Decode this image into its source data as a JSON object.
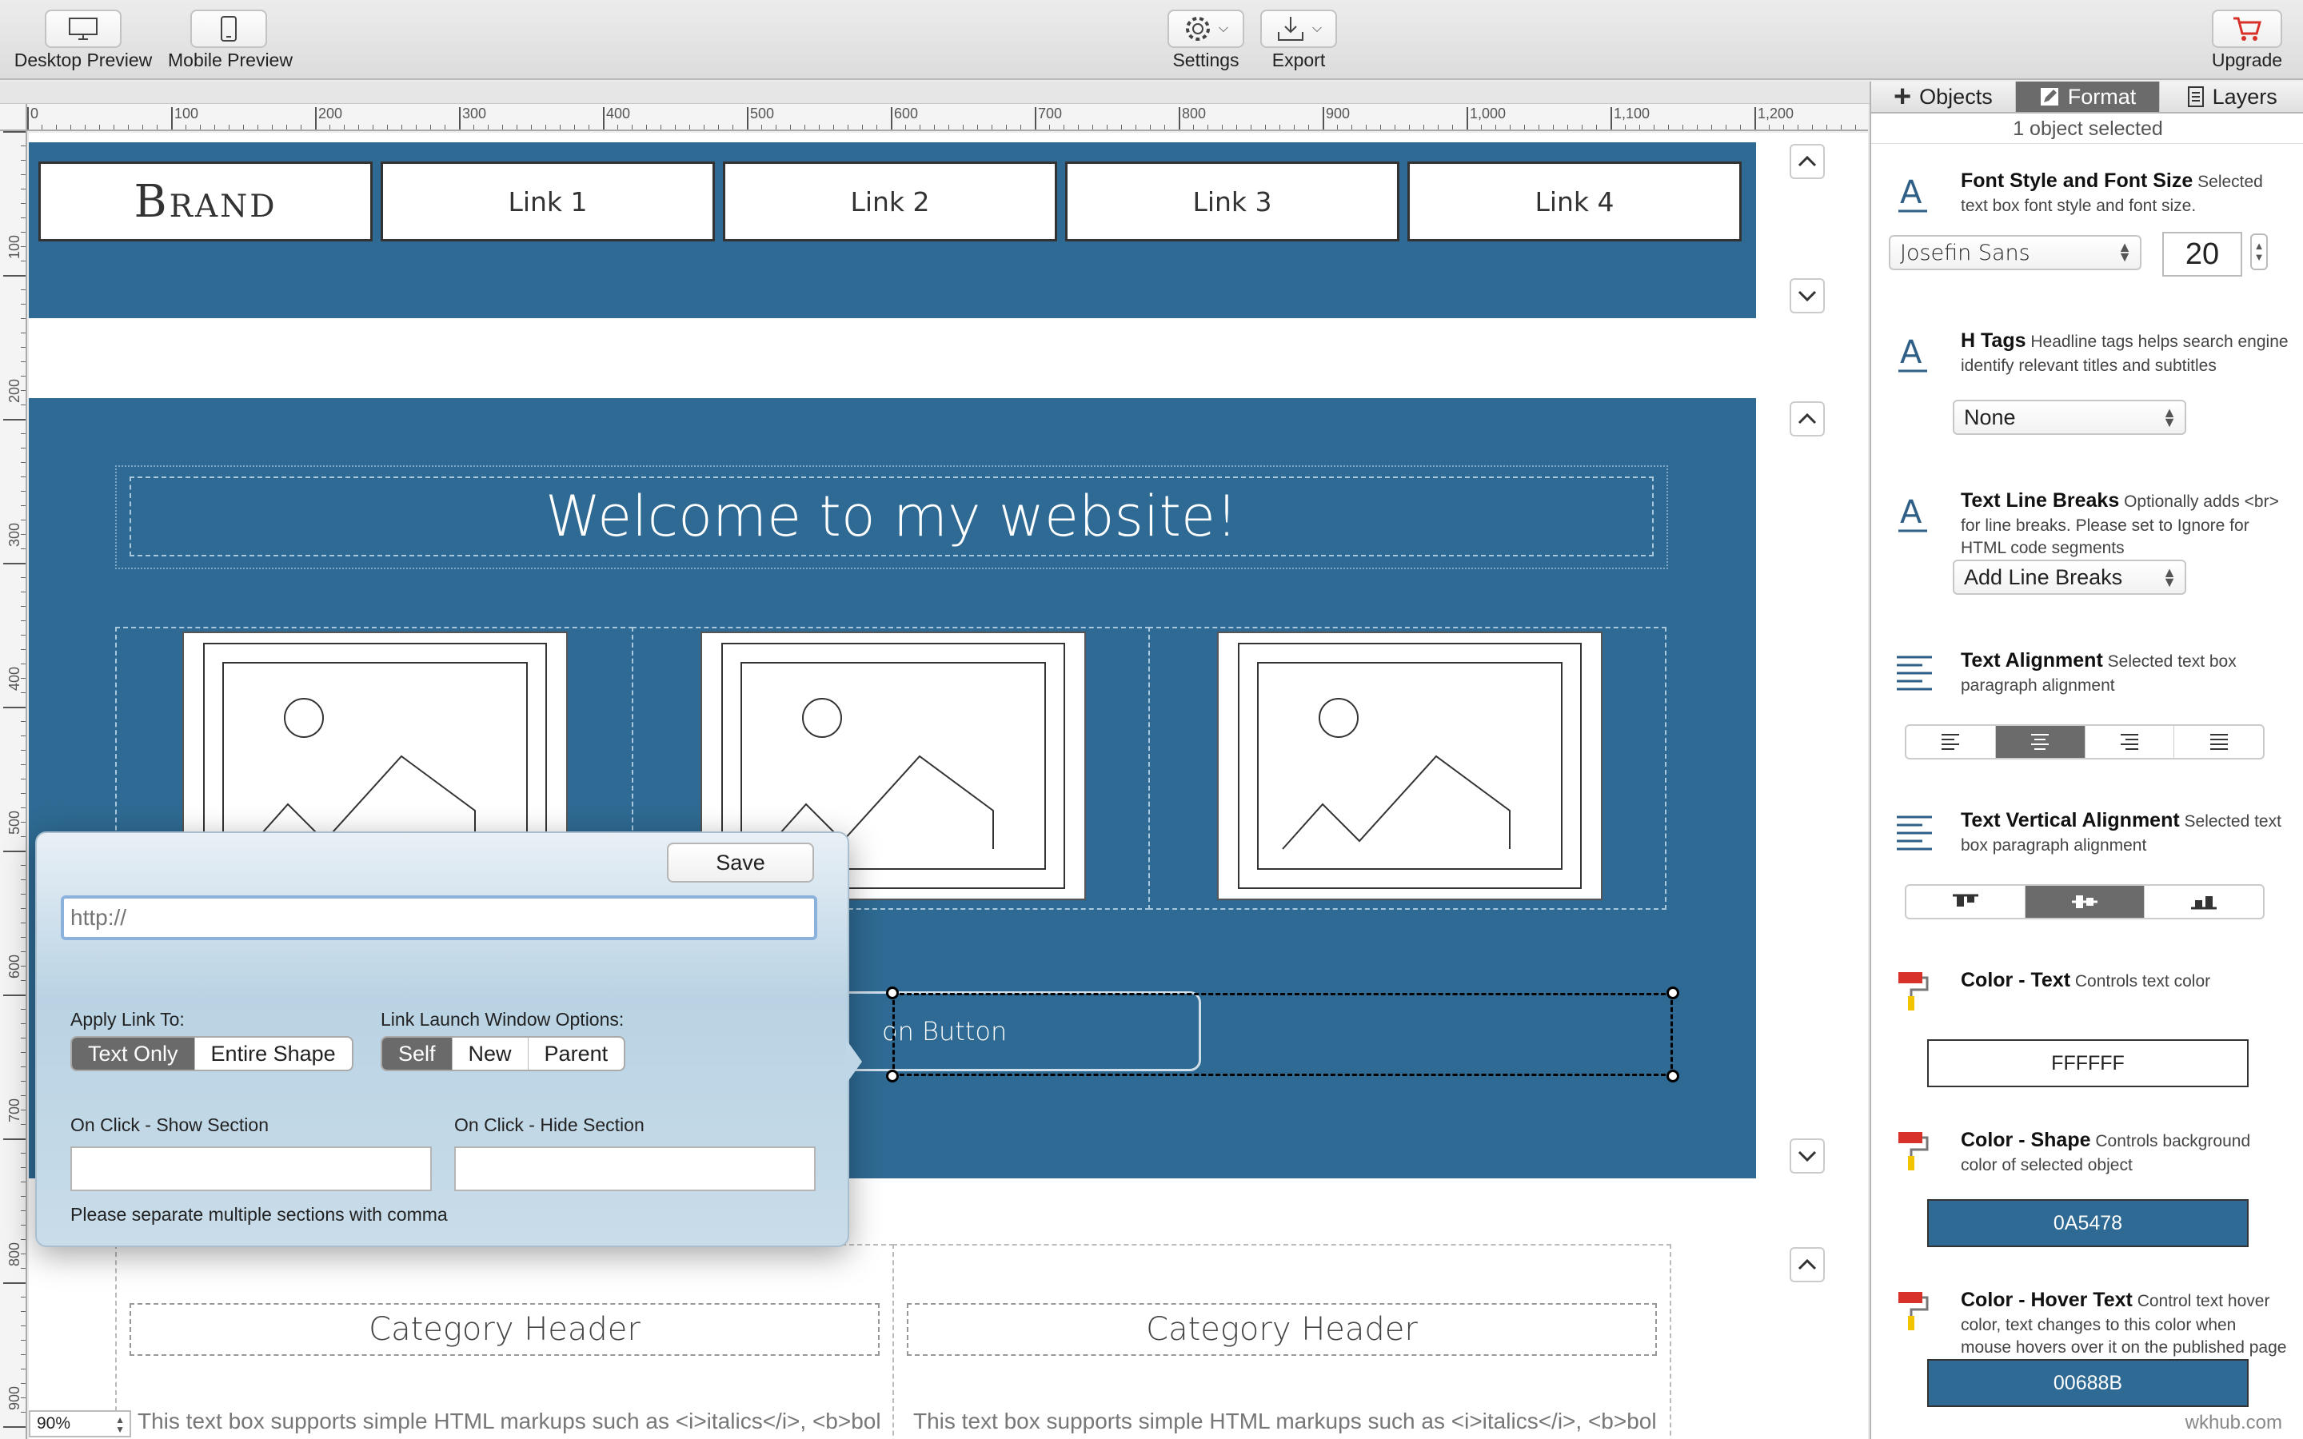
{
  "toolbar": {
    "desktop_preview": "Desktop Preview",
    "mobile_preview": "Mobile Preview",
    "settings": "Settings",
    "export": "Export",
    "upgrade": "Upgrade"
  },
  "ruler": {
    "top": [
      "0",
      "100",
      "200",
      "300",
      "400",
      "500",
      "600",
      "700",
      "800",
      "900",
      "1,000",
      "1,100",
      "1,200"
    ],
    "left": [
      "100",
      "200",
      "300",
      "400",
      "500",
      "600",
      "700",
      "800",
      "900"
    ]
  },
  "canvas": {
    "nav": {
      "brand": "Brand",
      "links": [
        "Link 1",
        "Link 2",
        "Link 3",
        "Link 4"
      ]
    },
    "welcome_title": "Welcome to my website!",
    "button_text": "on Button",
    "category_headers": [
      "Category Header",
      "Category Header"
    ],
    "body_text": [
      "This text box supports simple HTML markups such as <i>italics</i>, <b>bold</",
      "This text box supports simple HTML markups such as <i>italics</i>, <b>bold</"
    ],
    "band_color": "#2E6A93"
  },
  "link_popover": {
    "save_label": "Save",
    "url_placeholder": "http://",
    "apply_label": "Apply Link To:",
    "apply_options": [
      "Text Only",
      "Entire Shape"
    ],
    "apply_selected": "Text Only",
    "window_label": "Link Launch Window Options:",
    "window_options": [
      "Self",
      "New",
      "Parent"
    ],
    "window_selected": "Self",
    "show_section_label": "On Click - Show Section",
    "hide_section_label": "On Click - Hide Section",
    "note": "Please separate multiple sections with comma"
  },
  "sidebar": {
    "tabs": [
      "Objects",
      "Format",
      "Layers"
    ],
    "active_tab": "Format",
    "selection_status": "1 object selected",
    "font": {
      "title": "Font Style and Font Size",
      "desc_inline": "Selected",
      "desc": "text box font style and font size.",
      "family": "Josefin Sans",
      "size": "20"
    },
    "htags": {
      "title": "H Tags",
      "desc_inline": "Headline tags helps search engine",
      "desc": "identify relevant titles and subtitles",
      "value": "None"
    },
    "line_breaks": {
      "title": "Text Line Breaks",
      "desc_inline": "Optionally adds <br>",
      "desc": "for line breaks.  Please set to Ignore for HTML code segments",
      "value": "Add Line Breaks"
    },
    "alignment": {
      "title": "Text Alignment",
      "desc_inline": "Selected text box",
      "desc": "paragraph alignment",
      "selected_index": 1
    },
    "valignment": {
      "title": "Text Vertical Alignment",
      "desc_inline": "Selected text",
      "desc": "box paragraph alignment",
      "selected_index": 1
    },
    "color_text": {
      "title": "Color - Text",
      "desc_inline": "Controls text color",
      "desc": "",
      "value": "FFFFFF",
      "swatch": "#FFFFFF"
    },
    "color_shape": {
      "title": "Color - Shape",
      "desc_inline": "Controls background",
      "desc": "color of selected object",
      "value": "0A5478",
      "swatch": "#2E6A93"
    },
    "color_hover": {
      "title": "Color - Hover Text",
      "desc_inline": "Control text hover",
      "desc": "color, text changes to this color when mouse hovers over it on the published page",
      "value": "00688B",
      "swatch": "#2E6A93"
    }
  },
  "zoom": "90%",
  "watermark": "wkhub.com"
}
